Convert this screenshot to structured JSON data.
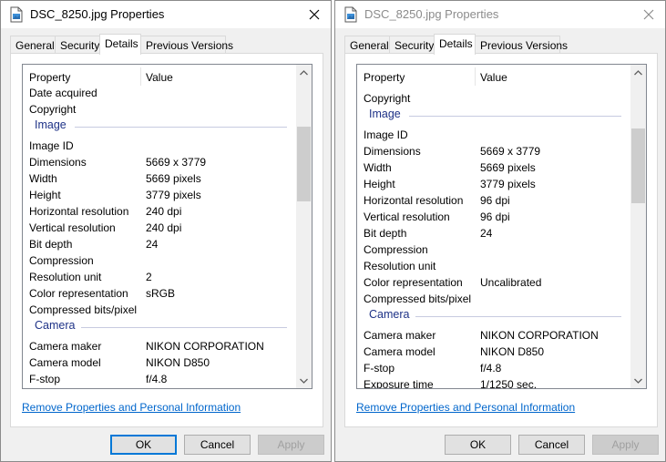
{
  "left_dialog": {
    "title": "DSC_8250.jpg Properties",
    "tabs": [
      "General",
      "Security",
      "Details",
      "Previous Versions"
    ],
    "active_tab": "Details",
    "columns": {
      "property": "Property",
      "value": "Value"
    },
    "rows": [
      {
        "kind": "item",
        "property": "Date acquired",
        "value": ""
      },
      {
        "kind": "item",
        "property": "Copyright",
        "value": ""
      },
      {
        "kind": "group",
        "title": "Image"
      },
      {
        "kind": "item",
        "property": "Image ID",
        "value": ""
      },
      {
        "kind": "item",
        "property": "Dimensions",
        "value": "5669 x 3779"
      },
      {
        "kind": "item",
        "property": "Width",
        "value": "5669 pixels"
      },
      {
        "kind": "item",
        "property": "Height",
        "value": "3779 pixels"
      },
      {
        "kind": "item",
        "property": "Horizontal resolution",
        "value": "240 dpi"
      },
      {
        "kind": "item",
        "property": "Vertical resolution",
        "value": "240 dpi"
      },
      {
        "kind": "item",
        "property": "Bit depth",
        "value": "24"
      },
      {
        "kind": "item",
        "property": "Compression",
        "value": ""
      },
      {
        "kind": "item",
        "property": "Resolution unit",
        "value": "2"
      },
      {
        "kind": "item",
        "property": "Color representation",
        "value": "sRGB"
      },
      {
        "kind": "item",
        "property": "Compressed bits/pixel",
        "value": ""
      },
      {
        "kind": "group",
        "title": "Camera"
      },
      {
        "kind": "item",
        "property": "Camera maker",
        "value": "NIKON CORPORATION"
      },
      {
        "kind": "item",
        "property": "Camera model",
        "value": "NIKON D850"
      },
      {
        "kind": "item",
        "property": "F-stop",
        "value": "f/4.8"
      }
    ],
    "link": "Remove Properties and Personal Information",
    "buttons": {
      "ok": "OK",
      "cancel": "Cancel",
      "apply": "Apply"
    }
  },
  "right_dialog": {
    "title": "DSC_8250.jpg Properties",
    "tabs": [
      "General",
      "Security",
      "Details",
      "Previous Versions"
    ],
    "active_tab": "Details",
    "columns": {
      "property": "Property",
      "value": "Value"
    },
    "rows": [
      {
        "kind": "item",
        "property": "Copyright",
        "value": ""
      },
      {
        "kind": "group",
        "title": "Image"
      },
      {
        "kind": "item",
        "property": "Image ID",
        "value": ""
      },
      {
        "kind": "item",
        "property": "Dimensions",
        "value": "5669 x 3779"
      },
      {
        "kind": "item",
        "property": "Width",
        "value": "5669 pixels"
      },
      {
        "kind": "item",
        "property": "Height",
        "value": "3779 pixels"
      },
      {
        "kind": "item",
        "property": "Horizontal resolution",
        "value": "96 dpi"
      },
      {
        "kind": "item",
        "property": "Vertical resolution",
        "value": "96 dpi"
      },
      {
        "kind": "item",
        "property": "Bit depth",
        "value": "24"
      },
      {
        "kind": "item",
        "property": "Compression",
        "value": ""
      },
      {
        "kind": "item",
        "property": "Resolution unit",
        "value": ""
      },
      {
        "kind": "item",
        "property": "Color representation",
        "value": "Uncalibrated"
      },
      {
        "kind": "item",
        "property": "Compressed bits/pixel",
        "value": ""
      },
      {
        "kind": "group",
        "title": "Camera"
      },
      {
        "kind": "item",
        "property": "Camera maker",
        "value": "NIKON CORPORATION"
      },
      {
        "kind": "item",
        "property": "Camera model",
        "value": "NIKON D850"
      },
      {
        "kind": "item",
        "property": "F-stop",
        "value": "f/4.8"
      },
      {
        "kind": "item",
        "property": "Exposure time",
        "value": "1/1250 sec."
      }
    ],
    "link": "Remove Properties and Personal Information",
    "buttons": {
      "ok": "OK",
      "cancel": "Cancel",
      "apply": "Apply"
    }
  },
  "icons": {
    "title": "image-file-icon",
    "close": "close-icon",
    "scroll_up": "chevron-up-icon",
    "scroll_down": "chevron-down-icon"
  },
  "colors": {
    "group_title": "#1e3287",
    "link": "#0066cc",
    "default_button_border": "#0078d7"
  }
}
